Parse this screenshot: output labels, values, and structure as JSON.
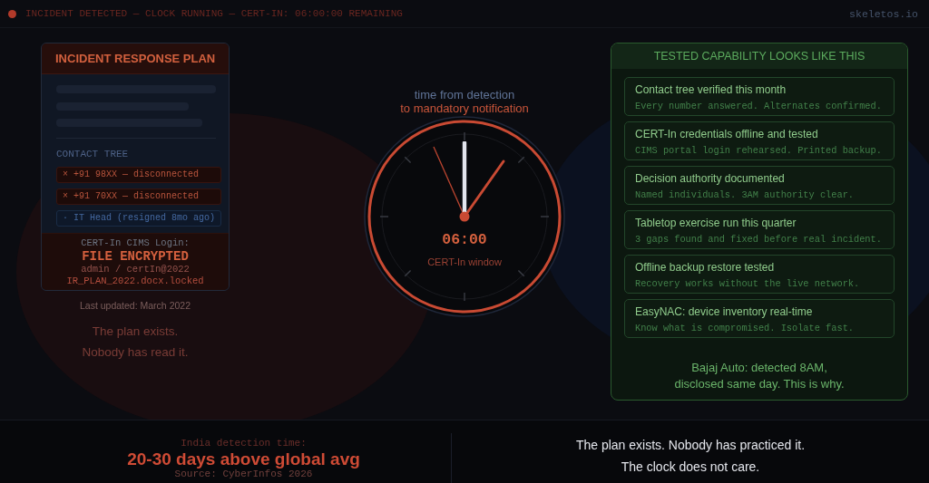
{
  "status_bar": {
    "text": "INCIDENT DETECTED — CLOCK RUNNING — CERT-IN: 06:00:00 REMAINING",
    "site": "skeletos.io"
  },
  "plan_card": {
    "title": "INCIDENT RESPONSE PLAN",
    "section_label": "CONTACT TREE",
    "contacts": [
      {
        "kind": "failed",
        "text": "× +91 98XX — disconnected"
      },
      {
        "kind": "failed",
        "text": "× +91 70XX — disconnected"
      },
      {
        "kind": "stale",
        "text": "· IT Head (resigned 8mo ago)"
      }
    ],
    "hidden_lines": [
      {
        "kind": "label",
        "text": "CERT-In CIMS Login:"
      },
      {
        "kind": "secret",
        "text": "admin / certIn@2022"
      }
    ],
    "overlay": {
      "title": "FILE ENCRYPTED",
      "file": "IR_PLAN_2022.docx.locked"
    }
  },
  "plan_notes": {
    "updated": "Last updated: March 2022",
    "lines": [
      "The plan exists.",
      "Nobody has read it."
    ]
  },
  "clock": {
    "caption": [
      {
        "kind": "muted",
        "text": "time from detection"
      },
      {
        "kind": "alert",
        "text": "to mandatory notification"
      }
    ],
    "time": "06:00",
    "label": "CERT-In window"
  },
  "capability_card": {
    "title": "TESTED CAPABILITY LOOKS LIKE THIS",
    "items": [
      {
        "title": "Contact tree verified this month",
        "detail": "Every number answered. Alternates confirmed."
      },
      {
        "title": "CERT-In credentials offline and tested",
        "detail": "CIMS portal login rehearsed. Printed backup."
      },
      {
        "title": "Decision authority documented",
        "detail": "Named individuals. 3AM authority clear."
      },
      {
        "title": "Tabletop exercise run this quarter",
        "detail": "3 gaps found and fixed before real incident."
      },
      {
        "title": "Offline backup restore tested",
        "detail": "Recovery works without the live network."
      },
      {
        "title": "EasyNAC: device inventory real-time",
        "detail": "Know what is compromised. Isolate fast."
      }
    ],
    "footer": [
      "Bajaj Auto: detected 8AM,",
      "disclosed same day. This is why."
    ]
  },
  "footer": {
    "stat_label": "India detection time:",
    "stat_value": "20-30 days above global avg",
    "source": "Source: CyberInfos 2026",
    "message": [
      "The plan exists. Nobody has practiced it.",
      "The clock does not care."
    ]
  }
}
